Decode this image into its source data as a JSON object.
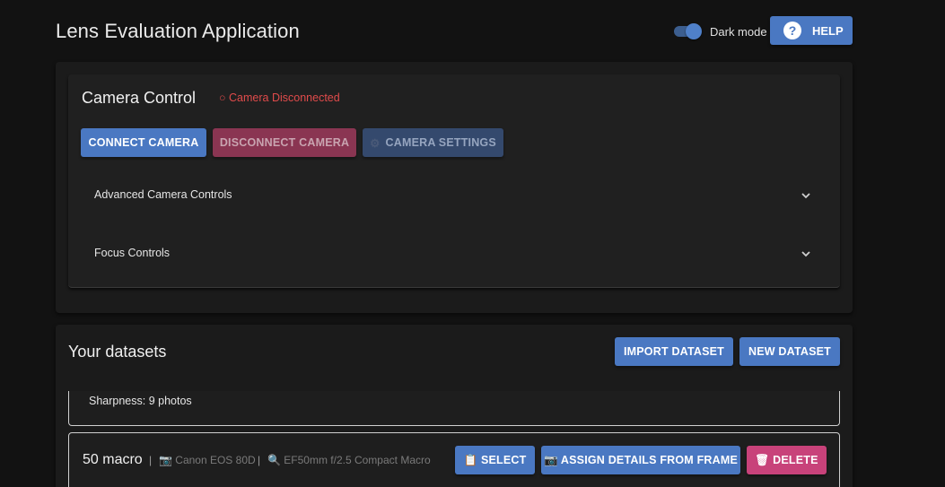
{
  "header": {
    "title": "Lens Evaluation Application",
    "dark_mode_label": "Dark mode",
    "dark_mode_on": true,
    "help_label": "HELP",
    "help_icon": "question-circle-icon"
  },
  "camera_control": {
    "title": "Camera Control",
    "status": "○ Camera Disconnected",
    "connect_label": "CONNECT CAMERA",
    "disconnect_label": "DISCONNECT CAMERA",
    "settings_label": "CAMERA SETTINGS",
    "settings_icon": "gear-icon",
    "accordions": [
      {
        "label": "Advanced Camera Controls",
        "icon": "chevron-down-icon"
      },
      {
        "label": "Focus Controls",
        "icon": "chevron-down-icon"
      }
    ]
  },
  "datasets": {
    "title": "Your datasets",
    "import_label": "IMPORT DATASET",
    "new_label": "NEW DATASET",
    "items": [
      {
        "summary": "Sharpness: 9 photos"
      },
      {
        "name": "50 macro",
        "separator": "|",
        "camera": "📷 Canon EOS 80D",
        "lens": "🔍 EF50mm f/2.5 Compact Macro",
        "select_label": "📋 SELECT",
        "assign_label": "📷 ASSIGN DETAILS FROM FRAME",
        "delete_label": "🗑 DELETE"
      }
    ]
  },
  "colors": {
    "primary": "#4a78c2",
    "danger": "#c8427a",
    "status_error": "#e04b4b",
    "background": "#121212"
  }
}
